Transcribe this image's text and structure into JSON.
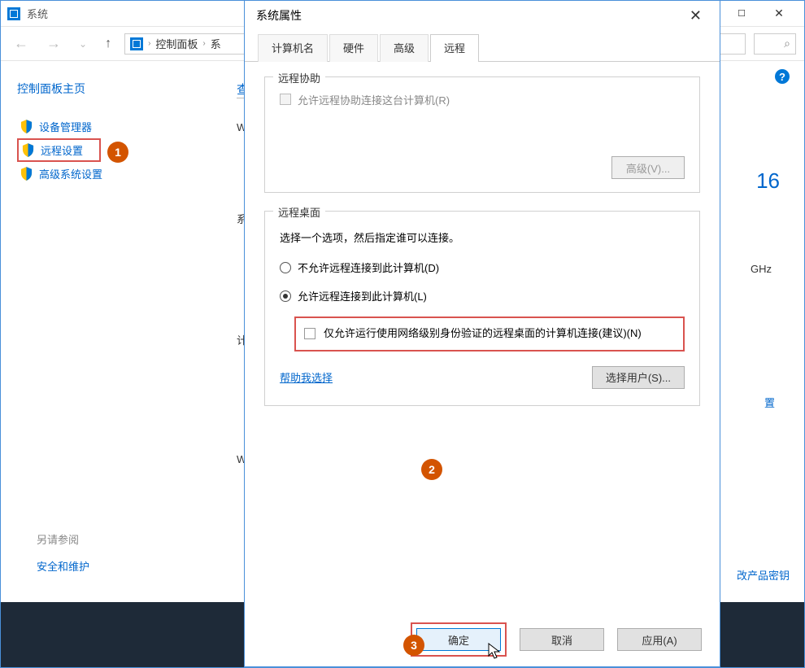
{
  "sys_window": {
    "title": "系统",
    "breadcrumb": {
      "item1": "控制面板",
      "item2": "系"
    },
    "sidebar": {
      "heading": "控制面板主页",
      "items": [
        {
          "label": "设备管理器"
        },
        {
          "label": "远程设置"
        },
        {
          "label": "高级系统设置"
        }
      ]
    },
    "main_fragments": {
      "heading": "查",
      "w1": "W",
      "sys": "系",
      "ji": "计",
      "w2": "W"
    },
    "right_fragments": {
      "big": "16",
      "ghz": "GHz",
      "zhi": "置",
      "key": "改产品密钥"
    },
    "see_also": {
      "label": "另请参阅",
      "link": "安全和维护"
    }
  },
  "dialog": {
    "title": "系统属性",
    "tabs": [
      {
        "label": "计算机名"
      },
      {
        "label": "硬件"
      },
      {
        "label": "高级"
      },
      {
        "label": "远程"
      }
    ],
    "remote_assist": {
      "legend": "远程协助",
      "checkbox_label": "允许远程协助连接这台计算机(R)",
      "advanced_btn": "高级(V)..."
    },
    "remote_desktop": {
      "legend": "远程桌面",
      "caption": "选择一个选项，然后指定谁可以连接。",
      "radio_deny": "不允许远程连接到此计算机(D)",
      "radio_allow": "允许远程连接到此计算机(L)",
      "nla_checkbox": "仅允许运行使用网络级别身份验证的远程桌面的计算机连接(建议)(N)",
      "help_link": "帮助我选择",
      "select_users_btn": "选择用户(S)..."
    },
    "footer": {
      "ok": "确定",
      "cancel": "取消",
      "apply": "应用(A)"
    }
  },
  "markers": {
    "m1": "1",
    "m2": "2",
    "m3": "3"
  }
}
